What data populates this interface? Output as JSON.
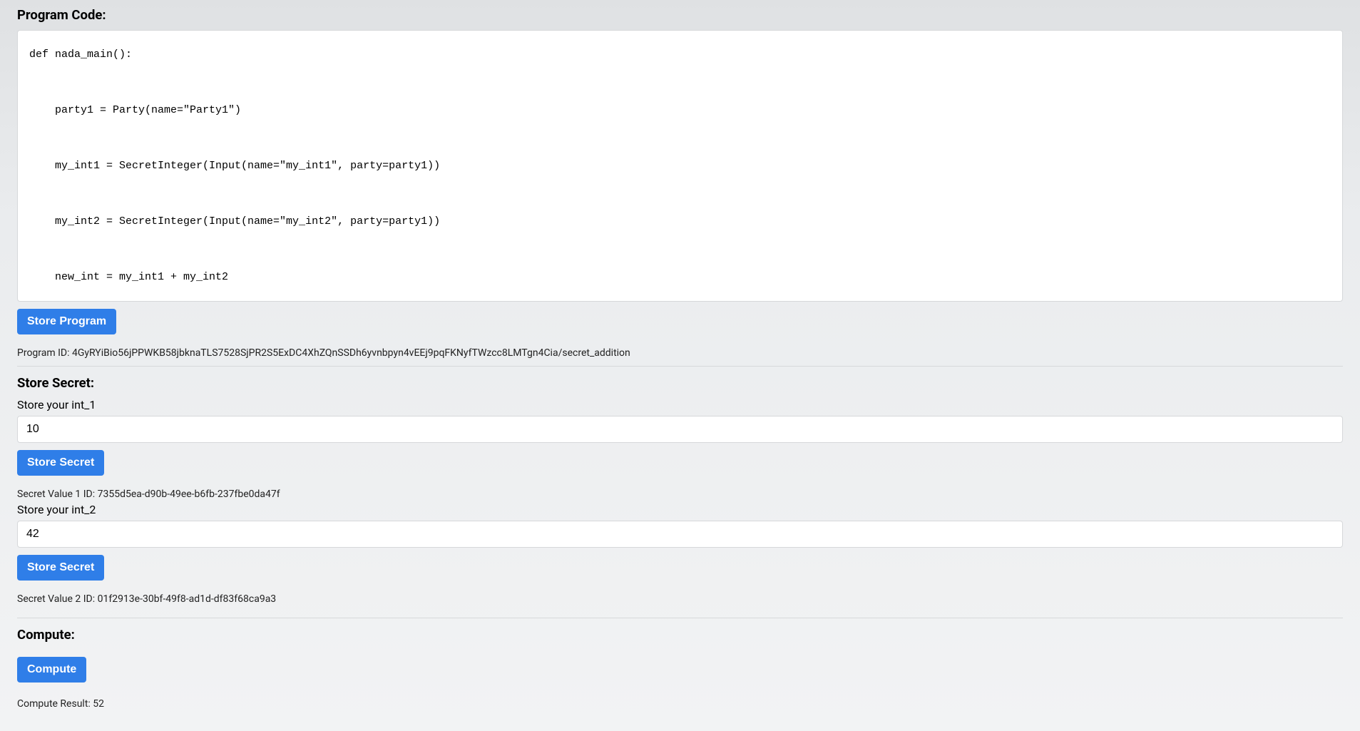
{
  "programCode": {
    "heading": "Program Code:",
    "code": "def nada_main():\n\n    party1 = Party(name=\"Party1\")\n\n    my_int1 = SecretInteger(Input(name=\"my_int1\", party=party1))\n\n    my_int2 = SecretInteger(Input(name=\"my_int2\", party=party1))\n\n    new_int = my_int1 + my_int2",
    "storeButton": "Store Program",
    "programIdLabel": "Program ID: ",
    "programIdValue": "4GyRYiBio56jPPWKB58jbknaTLS7528SjPR2S5ExDC4XhZQnSSDh6yvnbpyn4vEEj9pqFKNyfTWzcc8LMTgn4Cia/secret_addition"
  },
  "storeSecret": {
    "heading": "Store Secret:",
    "int1": {
      "label": "Store your int_1",
      "value": "10",
      "button": "Store Secret",
      "idLabel": "Secret Value 1 ID: ",
      "idValue": "7355d5ea-d90b-49ee-b6fb-237fbe0da47f"
    },
    "int2": {
      "label": "Store your int_2",
      "value": "42",
      "button": "Store Secret",
      "idLabel": "Secret Value 2 ID: ",
      "idValue": "01f2913e-30bf-49f8-ad1d-df83f68ca9a3"
    }
  },
  "compute": {
    "heading": "Compute:",
    "button": "Compute",
    "resultLabel": "Compute Result: ",
    "resultValue": "52"
  }
}
